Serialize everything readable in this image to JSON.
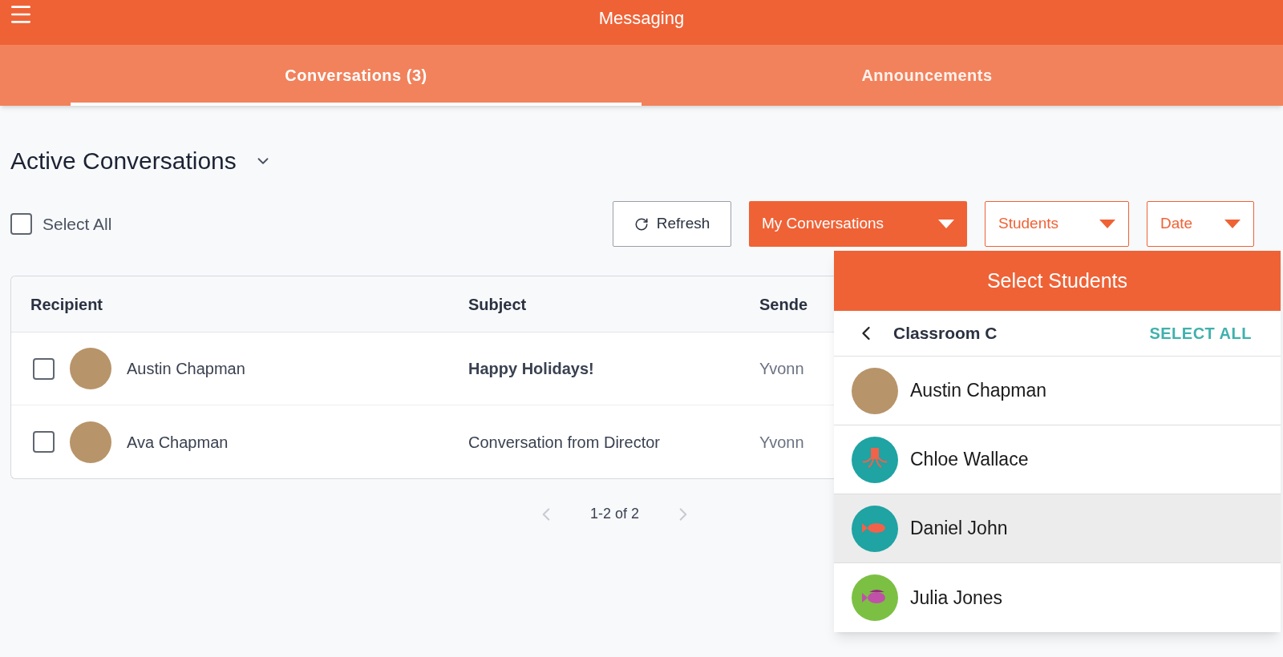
{
  "header": {
    "title": "Messaging"
  },
  "tabs": [
    {
      "label": "Conversations (3)",
      "selected": true
    },
    {
      "label": "Announcements",
      "selected": false
    }
  ],
  "section": {
    "title": "Active Conversations"
  },
  "select_all": {
    "label": "Select All",
    "checked": false
  },
  "toolbar": {
    "refresh": "Refresh",
    "filters": [
      {
        "label": "My Conversations",
        "kind": "filled"
      },
      {
        "label": "Students",
        "kind": "outlined"
      },
      {
        "label": "Date",
        "kind": "outlined"
      }
    ]
  },
  "table": {
    "columns": [
      "Recipient",
      "Subject",
      "Sende"
    ],
    "rows": [
      {
        "recipient": "Austin Chapman",
        "checked": false,
        "subject": "Happy Holidays!",
        "unread": true,
        "sender": "Yvonn"
      },
      {
        "recipient": "Ava Chapman",
        "checked": false,
        "subject": "Conversation from Director",
        "unread": false,
        "sender": "Yvonn"
      }
    ]
  },
  "pagination": {
    "range": "1-2 of 2"
  },
  "student_picker": {
    "title": "Select Students",
    "classroom": "Classroom C",
    "select_all": "SELECT ALL",
    "students": [
      {
        "name": "Austin Chapman",
        "kind": "photo",
        "selected": false
      },
      {
        "name": "Chloe Wallace",
        "kind": "octopus",
        "color": "#1fa3a3",
        "selected": false
      },
      {
        "name": "Daniel John",
        "kind": "fish",
        "color": "#1fa3a3",
        "selected": true
      },
      {
        "name": "Julia Jones",
        "kind": "striped-fish",
        "color": "#7bc043",
        "selected": false
      }
    ]
  }
}
